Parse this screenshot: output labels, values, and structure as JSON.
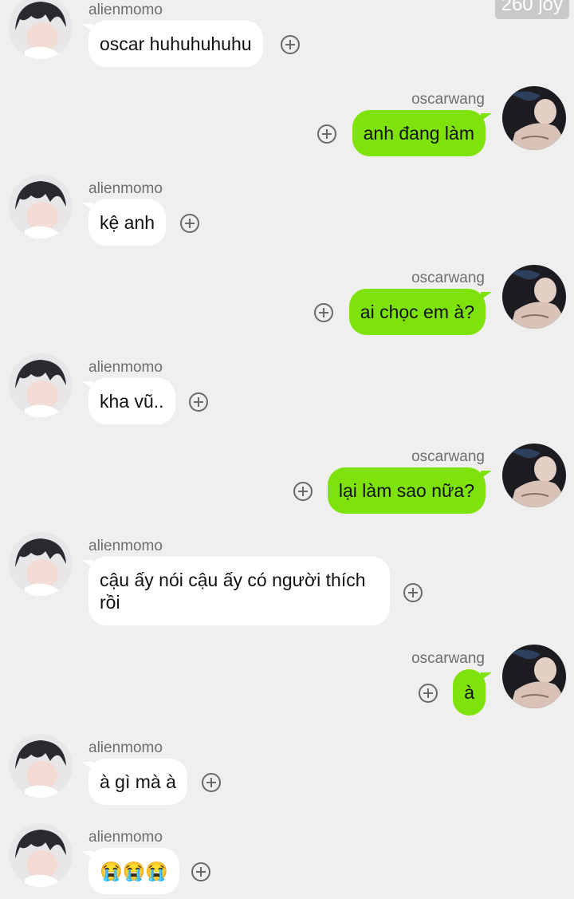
{
  "watermark": "260 joy",
  "users": {
    "left": "alienmomo",
    "right": "oscarwang"
  },
  "messages": [
    {
      "side": "in",
      "sender": "alienmomo",
      "text": "oscar huhuhuhuhu"
    },
    {
      "side": "out",
      "sender": "oscarwang",
      "text": "anh đang làm"
    },
    {
      "side": "in",
      "sender": "alienmomo",
      "text": "kệ anh"
    },
    {
      "side": "out",
      "sender": "oscarwang",
      "text": "ai chọc em à?"
    },
    {
      "side": "in",
      "sender": "alienmomo",
      "text": "kha vũ.."
    },
    {
      "side": "out",
      "sender": "oscarwang",
      "text": "lại làm sao nữa?"
    },
    {
      "side": "in",
      "sender": "alienmomo",
      "text": "cậu ấy nói cậu ấy có người thích\nrồi"
    },
    {
      "side": "out",
      "sender": "oscarwang",
      "text": "à"
    },
    {
      "side": "in",
      "sender": "alienmomo",
      "text": "à gì mà à"
    },
    {
      "side": "in",
      "sender": "alienmomo",
      "text": "😭😭😭"
    }
  ]
}
